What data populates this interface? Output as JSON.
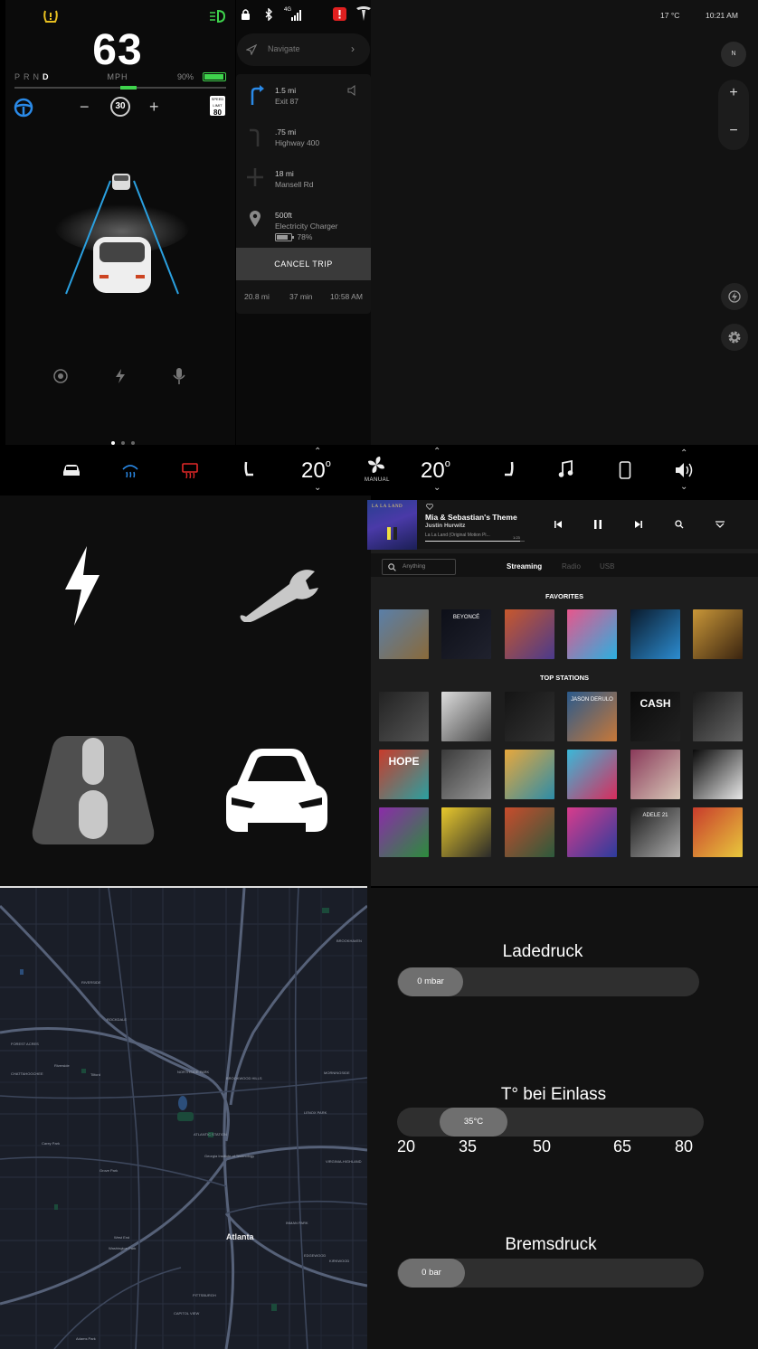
{
  "dashboard": {
    "speed": "63",
    "speed_unit": "MPH",
    "gears": [
      "P",
      "R",
      "N",
      "D"
    ],
    "active_gear": "D",
    "battery_percent": "90%",
    "cruise_speed": "30",
    "speed_limit_label": "SPEED LIMIT",
    "speed_limit": "80",
    "page_dots": 3
  },
  "navigation": {
    "search_placeholder": "Navigate",
    "steps": [
      {
        "distance": "1.5 mi",
        "road": "Exit 87"
      },
      {
        "distance": ".75 mi",
        "road": "Highway 400"
      },
      {
        "distance": "18 mi",
        "road": "Mansell Rd"
      },
      {
        "distance": "500ft",
        "road": "Electricity Charger",
        "charge": "78%"
      }
    ],
    "cancel_label": "CANCEL TRIP",
    "trip_distance": "20.8 mi",
    "trip_duration": "37 min",
    "arrival_time": "10:58 AM"
  },
  "status_bar": {
    "outside_temp": "17 °C",
    "time": "10:21 AM",
    "network": "4G",
    "compass": "N",
    "zoom_in": "+",
    "zoom_out": "−"
  },
  "climate": {
    "driver_temp": "20",
    "passenger_temp": "20",
    "degree": "o",
    "fan_mode": "MANUAL"
  },
  "media": {
    "track": "Mia & Sebastian's Theme",
    "artist": "Justin Hurwitz",
    "album": "La La Land (Original Motion Pi...",
    "time": "1:23",
    "progress": 0.95,
    "search_placeholder": "Anything",
    "tabs": [
      "Streaming",
      "Radio",
      "USB"
    ],
    "active_tab": "Streaming",
    "favorites_title": "FAVORITES",
    "top_stations_title": "TOP STATIONS",
    "favorite_covers": [
      {
        "c1": "#5a7fa8",
        "c2": "#8a6a3a",
        "label": ""
      },
      {
        "c1": "#0d0f18",
        "c2": "#20222e",
        "label": "BEYONCÉ"
      },
      {
        "c1": "#c8582c",
        "c2": "#4a3a8c",
        "label": ""
      },
      {
        "c1": "#e8568c",
        "c2": "#2ab0e0",
        "label": ""
      },
      {
        "c1": "#0a1a2c",
        "c2": "#2c8cd0",
        "label": ""
      },
      {
        "c1": "#c89638",
        "c2": "#3a2410",
        "label": ""
      }
    ],
    "station_covers": [
      {
        "c1": "#222",
        "c2": "#555",
        "label": ""
      },
      {
        "c1": "#ddd",
        "c2": "#444",
        "label": ""
      },
      {
        "c1": "#141414",
        "c2": "#333",
        "label": ""
      },
      {
        "c1": "#2a5a8c",
        "c2": "#c87838",
        "label": "JASON DERULO"
      },
      {
        "c1": "#0a0a0a",
        "c2": "#222",
        "label": "CASH"
      },
      {
        "c1": "#1a1a1a",
        "c2": "#666",
        "label": ""
      },
      {
        "c1": "#c83c2c",
        "c2": "#2aa0a0",
        "label": "HOPE"
      },
      {
        "c1": "#3a3a3a",
        "c2": "#9a9a9a",
        "label": ""
      },
      {
        "c1": "#e8a83c",
        "c2": "#2c8ca8",
        "label": ""
      },
      {
        "c1": "#3ab8d8",
        "c2": "#d82c5c",
        "label": ""
      },
      {
        "c1": "#8a3a5a",
        "c2": "#d8c8b8",
        "label": ""
      },
      {
        "c1": "#0a0a0a",
        "c2": "#e8e8e8",
        "label": ""
      },
      {
        "c1": "#8a2ca8",
        "c2": "#2c8c3c",
        "label": ""
      },
      {
        "c1": "#e8c82c",
        "c2": "#2a2a2a",
        "label": ""
      },
      {
        "c1": "#c84c2c",
        "c2": "#2c5a3c",
        "label": ""
      },
      {
        "c1": "#d83c8c",
        "c2": "#2c3c9c",
        "label": ""
      },
      {
        "c1": "#1a1a1a",
        "c2": "#aaa",
        "label": "ADELE 21"
      },
      {
        "c1": "#c83c2c",
        "c2": "#e8c83c",
        "label": ""
      }
    ]
  },
  "map_labels": [
    {
      "text": "BROOKHAVEN"
    },
    {
      "text": "RIVERSIDE"
    },
    {
      "text": "ROCKDALE"
    },
    {
      "text": "FOREST ACRES"
    },
    {
      "text": "CHATTAHOOCHEE"
    },
    {
      "text": "Riverside"
    },
    {
      "text": "Tilford"
    },
    {
      "text": "NORTHSIDE PARK"
    },
    {
      "text": "BROOKWOOD HILLS"
    },
    {
      "text": "MORNINGSIDE"
    },
    {
      "text": "LENOX PARK"
    },
    {
      "text": "Carey Park"
    },
    {
      "text": "Grove Park"
    },
    {
      "text": "ATLANTIC STATION"
    },
    {
      "text": "Georgia Institute of Technology"
    },
    {
      "text": "VIRGINIA-HIGHLAND"
    },
    {
      "text": "INMAN PARK"
    },
    {
      "text": "EDGEWOOD"
    },
    {
      "text": "KIRKWOOD"
    },
    {
      "text": "West End"
    },
    {
      "text": "Washington Park"
    },
    {
      "text": "PITTSBURGH"
    },
    {
      "text": "CAPITOL VIEW"
    },
    {
      "text": "Adams Park"
    }
  ],
  "map_city": "Atlanta",
  "gauges": [
    {
      "title": "Ladedruck",
      "value": "0 mbar"
    },
    {
      "title": "T° bei Einlass",
      "value": "35°C",
      "ticks": [
        "20",
        "35",
        "50",
        "65",
        "80"
      ]
    },
    {
      "title": "Bremsdruck",
      "value": "0 bar"
    }
  ]
}
